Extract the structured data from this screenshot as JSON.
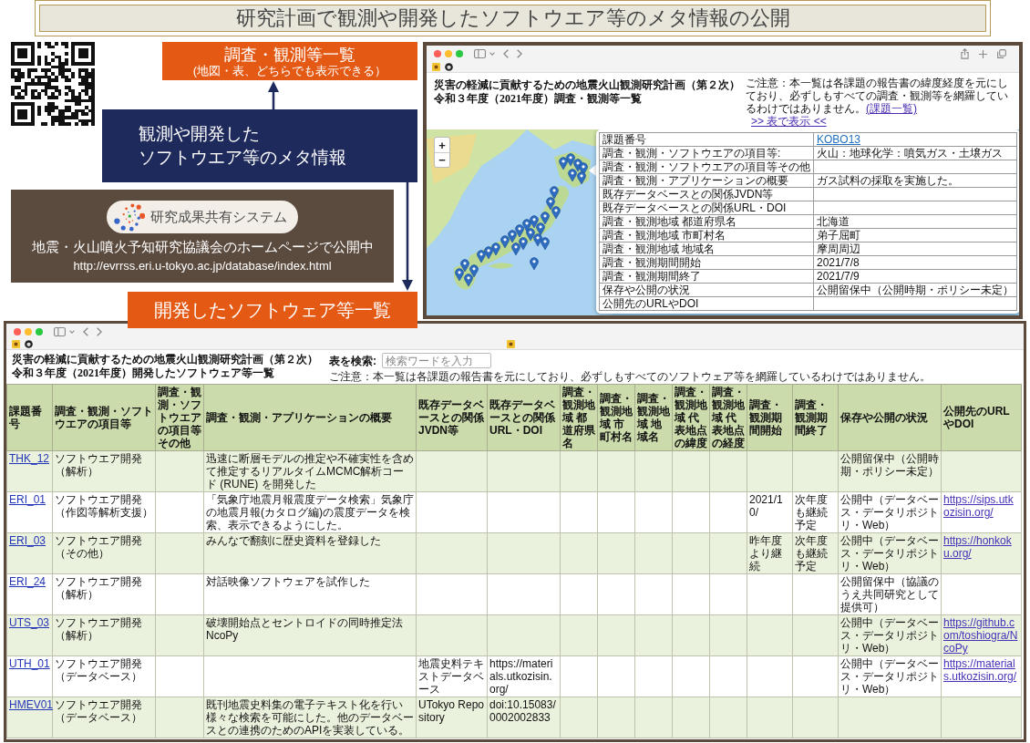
{
  "header": {
    "title": "研究計画で観測や開発したソフトウエア等のメタ情報の公開"
  },
  "banner": {
    "logo_text": "研究成果共有システム",
    "message": "地震・火山噴火予知研究協議会のホームページで公開中",
    "url": "http://evrrss.eri.u-tokyo.ac.jp/database/index.html"
  },
  "map_view": {
    "label": {
      "title": "調査・観測等一覧",
      "subtitle": "(地図・表、どちらでも表示できる）"
    },
    "page_title": [
      "災害の軽減に貢献するための地震火山観測研究計画（第２次）",
      "令和３年度（2021年度）調査・観測等一覧"
    ],
    "notice": "ご注意：本一覧は各課題の報告書の緯度経度を元にしており、必ずしもすべての調査・観測等を網羅しているわけではありません。",
    "notice_link": "(課題一覧)",
    "table_link": ">> 表で表示 <<",
    "zoom_controls": [
      "+",
      "−"
    ],
    "popup": {
      "id_row": {
        "label": "課題番号",
        "value": "KOBO13"
      },
      "rows": [
        {
          "label": "調査・観測・ソフトウエアの項目等:",
          "value": "火山：地球化学：噴気ガス・土壌ガス"
        },
        {
          "label": "調査・観測・ソフトウエアの項目等その他"
        },
        {
          "label": "調査・観測・アプリケーションの概要",
          "value": "ガス試料の採取を実施した。"
        },
        {
          "label": "既存データベースとの関係JVDN等"
        },
        {
          "label": "既存データベースとの関係URL・DOI"
        },
        {
          "label": "調査・観測地域 都道府県名",
          "value": "北海道"
        },
        {
          "label": "調査・観測地域 市町村名",
          "value": "弟子屈町"
        },
        {
          "label": "調査・観測地域 地域名",
          "value": "摩周周辺"
        },
        {
          "label": "調査・観測期間開始",
          "value": "2021/7/8"
        },
        {
          "label": "調査・観測期間終了",
          "value": "2021/7/9"
        },
        {
          "label": "保存や公開の状況",
          "value": "公開留保中（公開時期・ポリシー未定）"
        },
        {
          "label": "公開先のURLやDOI"
        }
      ]
    }
  },
  "callout": {
    "lines": [
      "観測や開発した",
      "ソフトウエア等のメタ情報"
    ]
  },
  "software_view": {
    "label": "開発したソフトウェア等一覧",
    "page_title": [
      "災害の軽減に貢献するための地震火山観測研究計画（第２次）",
      "令和３年度（2021年度）開発したソフトウェア等一覧"
    ],
    "search": {
      "label": "表を検索:",
      "placeholder": "検索ワードを入力"
    },
    "notice": "ご注意：本一覧は各課題の報告書を元にしており、必ずしもすべてのソフトウェア等を網羅しているわけではありません。",
    "table": {
      "columns": [
        "課題番号",
        "調査・観測・ソフトウエアの項目等",
        "調査・観測・ソフトウエアの項目等その他",
        "調査・観測・アプリケーションの概要",
        "既存データベースとの関係JVDN等",
        "既存データベースとの関係URL・DOI",
        "調査・観測地域 都道府県名",
        "調査・観測地域 市町村名",
        "調査・観測地域 地域名",
        "調査・観測地域 代表地点の緯度",
        "調査・観測地域 代表地点の経度",
        "調査・観測期間開始",
        "調査・観測期間終了",
        "保存や公開の状況",
        "公開先のURLやDOI"
      ],
      "rows": [
        [
          "THK_12",
          "ソフトウエア開発（解析）",
          "",
          "迅速に断層モデルの推定や不確実性を含めて推定するリアルタイムMCMC解析コード (RUNE) を開発した",
          "",
          "",
          "",
          "",
          "",
          "",
          "",
          "",
          "",
          "公開留保中（公開時期・ポリシー未定）",
          ""
        ],
        [
          "ERI_01",
          "ソフトウエア開発（作図等解析支援）",
          "",
          "「気象庁地震月報震度データ検索」気象庁の地震月報(カタログ編)の震度データを検索、表示できるようにした。",
          "",
          "",
          "",
          "",
          "",
          "",
          "",
          "2021/10/",
          "次年度も継続予定",
          "公開中（データベース・データリポジトリ・Web）",
          "https://sips.utkozisin.org/"
        ],
        [
          "ERI_03",
          "ソフトウエア開発（その他）",
          "",
          "みんなで翻刻に歴史資料を登録した",
          "",
          "",
          "",
          "",
          "",
          "",
          "",
          "昨年度より継続",
          "次年度も継続予定",
          "公開中（データベース・データリポジトリ・Web）",
          "https://honkoku.org/"
        ],
        [
          "ERI_24",
          "ソフトウエア開発（解析）",
          "",
          "対話映像ソフトウェアを試作した",
          "",
          "",
          "",
          "",
          "",
          "",
          "",
          "",
          "",
          "公開留保中（協議のうえ共同研究として提供可）",
          ""
        ],
        [
          "UTS_03",
          "ソフトウエア開発（解析）",
          "",
          "破壊開始点とセントロイドの同時推定法　NcoPy",
          "",
          "",
          "",
          "",
          "",
          "",
          "",
          "",
          "",
          "公開中（データベース・データリポジトリ・Web）",
          "https://github.com/toshiogra/NcoPy"
        ],
        [
          "UTH_01",
          "ソフトウエア開発（データベース）",
          "",
          "",
          "地震史料テキストデータベース",
          "https://materials.utkozisin.org/",
          "",
          "",
          "",
          "",
          "",
          "",
          "",
          "公開中（データベース・データリポジトリ・Web）",
          "https://materials.utkozisin.org/"
        ],
        [
          "HMEV01",
          "ソフトウエア開発（データベース）",
          "",
          "既刊地震史料集の電子テキスト化を行い様々な検索を可能にした。他のデータベースとの連携のためのAPIを実装している。",
          "UTokyo Repository",
          "doi:10.15083/0002002833",
          "",
          "",
          "",
          "",
          "",
          "",
          "",
          "",
          ""
        ]
      ]
    }
  }
}
